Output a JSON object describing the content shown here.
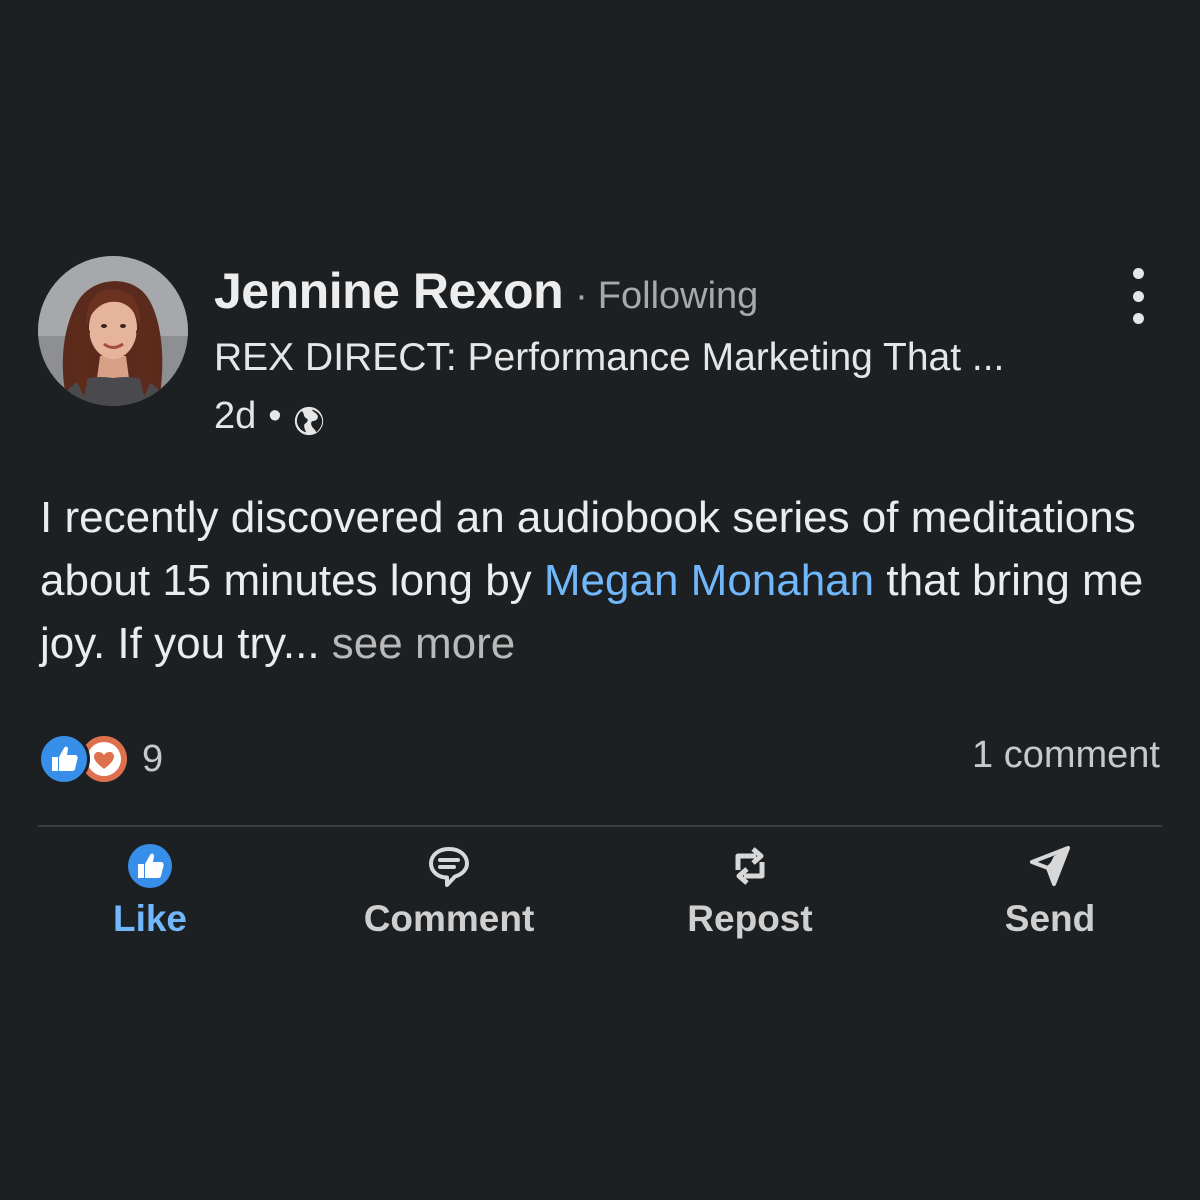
{
  "post": {
    "author": {
      "name": "Jennine Rexon",
      "separator": "·",
      "follow_status": "Following",
      "headline": "REX DIRECT: Performance Marketing That ...",
      "age": "2d",
      "meta_separator": "•",
      "visibility_icon": "globe-icon"
    },
    "body": {
      "text_before": "I recently discovered an audiobook series of meditations about 15 minutes long by ",
      "mention": "Megan Monahan",
      "text_after": " that bring me joy. If you try...",
      "see_more": " see more"
    },
    "social": {
      "reaction_icons": [
        "like-icon",
        "love-icon"
      ],
      "reaction_count": "9",
      "comment_count": "1 comment"
    },
    "actions": [
      {
        "label": "Like",
        "icon": "thumbs-up-icon"
      },
      {
        "label": "Comment",
        "icon": "speech-bubble-icon"
      },
      {
        "label": "Repost",
        "icon": "repost-icon"
      },
      {
        "label": "Send",
        "icon": "paper-plane-icon"
      }
    ]
  },
  "colors": {
    "background": "#1d2023",
    "link": "#71b7fb",
    "like_reaction": "#378fe9",
    "love_reaction": "#df704d"
  }
}
